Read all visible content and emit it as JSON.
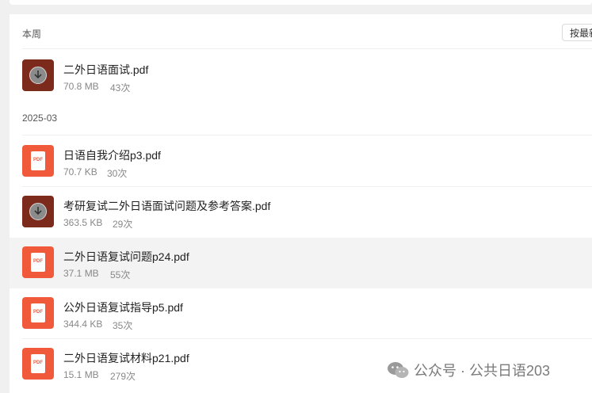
{
  "sections": {
    "this_week": "本周",
    "march": "2025-03"
  },
  "sort_button": "按最新",
  "files": [
    {
      "name": "二外日语面试.pdf",
      "size": "70.8 MB",
      "count": "43次",
      "icon": "download-icon"
    },
    {
      "name": "日语自我介绍p3.pdf",
      "size": "70.7 KB",
      "count": "30次",
      "icon": "pdf-icon"
    },
    {
      "name": "考研复试二外日语面试问题及参考答案.pdf",
      "size": "363.5 KB",
      "count": "29次",
      "icon": "download-icon"
    },
    {
      "name": "二外日语复试问题p24.pdf",
      "size": "37.1 MB",
      "count": "55次",
      "icon": "pdf-icon"
    },
    {
      "name": "公外日语复试指导p5.pdf",
      "size": "344.4 KB",
      "count": "35次",
      "icon": "pdf-icon"
    },
    {
      "name": "二外日语复试材料p21.pdf",
      "size": "15.1 MB",
      "count": "279次",
      "icon": "pdf-icon"
    }
  ],
  "pdf_label": "PDF",
  "watermark": "公众号 · 公共日语203",
  "colors": {
    "pdf_icon": "#f05a3a",
    "download_icon": "#7b2a1c",
    "highlight_row": "#f3f3f3"
  }
}
